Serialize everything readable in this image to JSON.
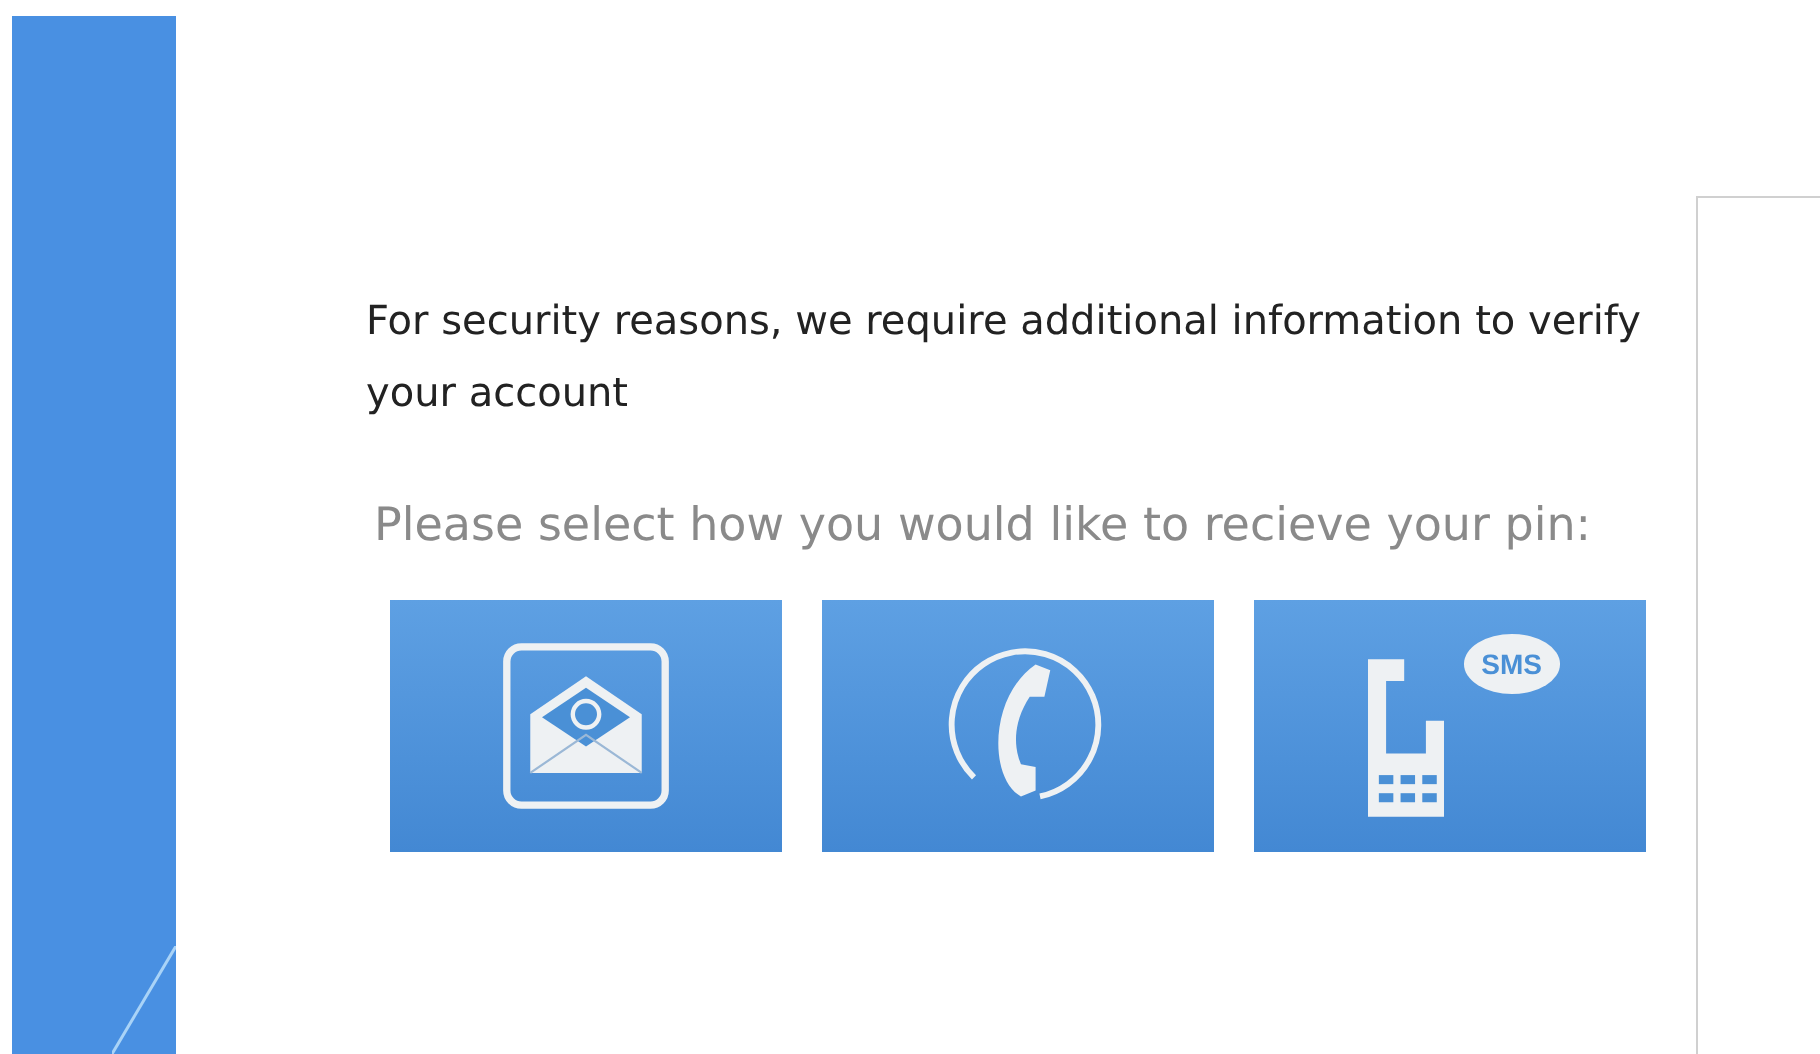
{
  "heading": "For security reasons, we require additional information to verify your account",
  "prompt": "Please select how you would like to recieve your pin:",
  "options": [
    {
      "kind": "email"
    },
    {
      "kind": "phone"
    },
    {
      "kind": "sms",
      "badge": "SMS"
    }
  ]
}
